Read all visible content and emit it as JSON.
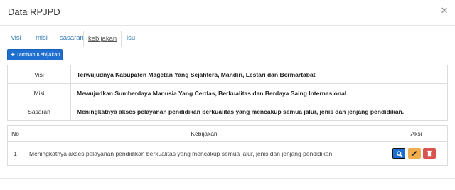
{
  "modal": {
    "title": "Data RPJPD",
    "close_glyph": "✕"
  },
  "tabs": [
    {
      "label": "visi",
      "active": false
    },
    {
      "label": "misi",
      "active": false
    },
    {
      "label": "sasaran",
      "active": false
    },
    {
      "label": "kebijakan",
      "active": true
    },
    {
      "label": "isu",
      "active": false
    }
  ],
  "add_button": {
    "icon": "plus-icon",
    "label": "Tambah Kebijakan"
  },
  "info_table": [
    {
      "label": "Visi",
      "value": "Terwujudnya Kabupaten Magetan Yang Sejahtera, Mandiri, Lestari dan Bermartabat"
    },
    {
      "label": "Misi",
      "value": "Mewujudkan Sumberdaya Manusia Yang Cerdas, Berkualitas dan Berdaya Saing Internasional"
    },
    {
      "label": "Sasaran",
      "value": "Meningkatnya akses pelayanan pendidikan berkualitas yang mencakup semua jalur, jenis dan jenjang pendidikan."
    }
  ],
  "kebijakan_table": {
    "headers": [
      "No",
      "Kebijakan",
      "Aksi"
    ],
    "rows": [
      {
        "no": "1",
        "kebijakan": "Meningkatnya akses pelayanan pendidikan berkualitas yang mencakup semua jalur, jenis dan jenjang pendidikan."
      }
    ]
  },
  "action_icons": [
    "search-icon",
    "pencil-icon",
    "trash-icon"
  ],
  "colors": {
    "primary": "#1f6fd1",
    "warning": "#f0ad4e",
    "danger": "#d9534f",
    "link": "#337ab7"
  }
}
